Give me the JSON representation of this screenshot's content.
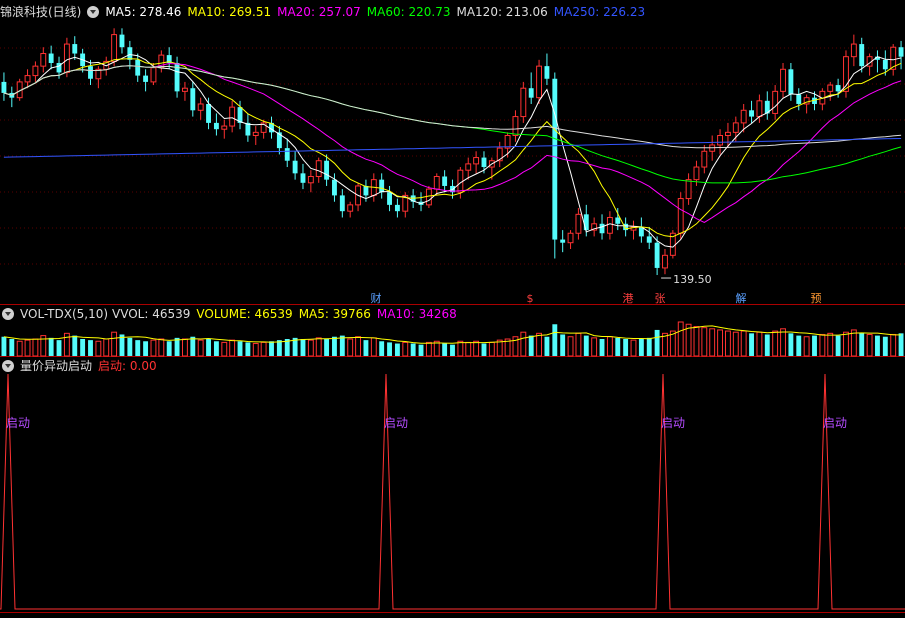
{
  "main": {
    "title": "锦浪科技(日线)",
    "ma": [
      {
        "label": "MA5: 278.46",
        "color": "#ffffff"
      },
      {
        "label": "MA10: 269.51",
        "color": "#ffff00"
      },
      {
        "label": "MA20: 257.07",
        "color": "#ff00ff"
      },
      {
        "label": "MA60: 220.73",
        "color": "#00ff00"
      },
      {
        "label": "MA120: 213.06",
        "color": "#dddddd"
      },
      {
        "label": "MA250: 226.23",
        "color": "#3355ff"
      }
    ],
    "low_marker": "139.50",
    "markers": [
      {
        "text": "财",
        "x": 376,
        "color": "#5aa0ff"
      },
      {
        "text": "$",
        "x": 530,
        "color": "#ff4040"
      },
      {
        "text": "港",
        "x": 628,
        "color": "#ff4040"
      },
      {
        "text": "张",
        "x": 660,
        "color": "#ff4040"
      },
      {
        "text": "解",
        "x": 741,
        "color": "#5aa0ff"
      },
      {
        "text": "预",
        "x": 816,
        "color": "#ff9933"
      }
    ]
  },
  "volume": {
    "title": "VOL-TDX(5,10)",
    "vvol": "VVOL: 46539",
    "volume": "VOLUME: 46539",
    "ma5": "MA5: 39766",
    "ma10": "MA10: 34268"
  },
  "indicator": {
    "title": "量价异动启动",
    "value_label": "启动: 0.00",
    "signal_label": "启动",
    "signals": [
      0.5,
      0.5,
      0.5,
      0.5
    ]
  },
  "colors": {
    "up": "#ff3232",
    "down": "#54fcfc",
    "frame": "#aa0000"
  },
  "chart_data": {
    "type": "candlestick",
    "title": "锦浪科技(日线)",
    "series": [
      {
        "name": "MA5",
        "last": 278.46
      },
      {
        "name": "MA10",
        "last": 269.51
      },
      {
        "name": "MA20",
        "last": 257.07
      },
      {
        "name": "MA60",
        "last": 220.73
      },
      {
        "name": "MA120",
        "last": 213.06
      },
      {
        "name": "MA250",
        "last": 226.23
      }
    ],
    "ohlc": [
      [
        262,
        268,
        250,
        255
      ],
      [
        255,
        259,
        246,
        252
      ],
      [
        252,
        264,
        250,
        262
      ],
      [
        262,
        270,
        258,
        266
      ],
      [
        266,
        275,
        262,
        272
      ],
      [
        272,
        284,
        268,
        280
      ],
      [
        280,
        285,
        270,
        274
      ],
      [
        274,
        278,
        264,
        268
      ],
      [
        268,
        290,
        265,
        286
      ],
      [
        286,
        291,
        276,
        280
      ],
      [
        280,
        283,
        268,
        272
      ],
      [
        272,
        276,
        260,
        264
      ],
      [
        264,
        272,
        258,
        270
      ],
      [
        270,
        278,
        266,
        275
      ],
      [
        275,
        296,
        272,
        292
      ],
      [
        292,
        296,
        280,
        284
      ],
      [
        284,
        288,
        270,
        276
      ],
      [
        276,
        280,
        262,
        266
      ],
      [
        266,
        270,
        256,
        262
      ],
      [
        262,
        274,
        260,
        271
      ],
      [
        271,
        282,
        268,
        279
      ],
      [
        279,
        284,
        270,
        274
      ],
      [
        274,
        278,
        252,
        256
      ],
      [
        256,
        262,
        250,
        258
      ],
      [
        258,
        262,
        240,
        244
      ],
      [
        244,
        252,
        238,
        248
      ],
      [
        248,
        252,
        232,
        236
      ],
      [
        236,
        242,
        228,
        232
      ],
      [
        232,
        238,
        226,
        234
      ],
      [
        234,
        250,
        230,
        246
      ],
      [
        246,
        250,
        232,
        236
      ],
      [
        236,
        242,
        224,
        228
      ],
      [
        228,
        234,
        222,
        230
      ],
      [
        230,
        238,
        226,
        236
      ],
      [
        236,
        240,
        226,
        230
      ],
      [
        230,
        234,
        216,
        220
      ],
      [
        220,
        226,
        208,
        212
      ],
      [
        212,
        218,
        200,
        204
      ],
      [
        204,
        210,
        194,
        198
      ],
      [
        198,
        206,
        192,
        202
      ],
      [
        202,
        214,
        198,
        212
      ],
      [
        212,
        216,
        196,
        200
      ],
      [
        200,
        204,
        186,
        190
      ],
      [
        190,
        194,
        176,
        180
      ],
      [
        180,
        186,
        176,
        184
      ],
      [
        184,
        198,
        180,
        196
      ],
      [
        196,
        200,
        186,
        190
      ],
      [
        190,
        204,
        186,
        200
      ],
      [
        200,
        204,
        188,
        192
      ],
      [
        192,
        196,
        180,
        184
      ],
      [
        184,
        188,
        176,
        180
      ],
      [
        180,
        192,
        176,
        190
      ],
      [
        190,
        194,
        182,
        186
      ],
      [
        186,
        192,
        180,
        184
      ],
      [
        184,
        196,
        182,
        194
      ],
      [
        194,
        204,
        190,
        202
      ],
      [
        202,
        206,
        192,
        196
      ],
      [
        196,
        200,
        188,
        192
      ],
      [
        192,
        208,
        188,
        206
      ],
      [
        206,
        214,
        200,
        210
      ],
      [
        210,
        218,
        204,
        214
      ],
      [
        214,
        218,
        204,
        208
      ],
      [
        208,
        214,
        200,
        212
      ],
      [
        212,
        224,
        208,
        220
      ],
      [
        220,
        230,
        214,
        228
      ],
      [
        228,
        244,
        224,
        240
      ],
      [
        240,
        262,
        236,
        258
      ],
      [
        258,
        268,
        248,
        252
      ],
      [
        252,
        276,
        248,
        272
      ],
      [
        272,
        280,
        260,
        264
      ],
      [
        264,
        268,
        150,
        162
      ],
      [
        162,
        168,
        154,
        160
      ],
      [
        160,
        168,
        156,
        166
      ],
      [
        166,
        182,
        162,
        178
      ],
      [
        178,
        184,
        164,
        168
      ],
      [
        168,
        176,
        164,
        172
      ],
      [
        172,
        178,
        162,
        166
      ],
      [
        166,
        180,
        162,
        176
      ],
      [
        176,
        182,
        168,
        172
      ],
      [
        172,
        176,
        164,
        168
      ],
      [
        168,
        174,
        162,
        170
      ],
      [
        170,
        176,
        160,
        164
      ],
      [
        164,
        170,
        156,
        160
      ],
      [
        160,
        164,
        139.5,
        144
      ],
      [
        144,
        156,
        140,
        152
      ],
      [
        152,
        168,
        150,
        166
      ],
      [
        166,
        192,
        162,
        188
      ],
      [
        188,
        204,
        184,
        200
      ],
      [
        200,
        212,
        196,
        208
      ],
      [
        208,
        222,
        204,
        218
      ],
      [
        218,
        228,
        212,
        222
      ],
      [
        222,
        232,
        216,
        228
      ],
      [
        228,
        236,
        220,
        230
      ],
      [
        230,
        240,
        224,
        236
      ],
      [
        236,
        248,
        230,
        244
      ],
      [
        244,
        250,
        236,
        240
      ],
      [
        240,
        254,
        236,
        250
      ],
      [
        250,
        256,
        238,
        242
      ],
      [
        242,
        260,
        238,
        256
      ],
      [
        256,
        274,
        252,
        270
      ],
      [
        270,
        274,
        250,
        254
      ],
      [
        254,
        258,
        244,
        248
      ],
      [
        248,
        254,
        242,
        252
      ],
      [
        252,
        256,
        244,
        248
      ],
      [
        248,
        258,
        244,
        256
      ],
      [
        256,
        262,
        250,
        260
      ],
      [
        260,
        264,
        252,
        256
      ],
      [
        256,
        282,
        252,
        278
      ],
      [
        278,
        292,
        272,
        286
      ],
      [
        286,
        290,
        268,
        272
      ],
      [
        272,
        280,
        266,
        278
      ],
      [
        278,
        282,
        268,
        276
      ],
      [
        276,
        282,
        266,
        270
      ],
      [
        270,
        286,
        266,
        284
      ],
      [
        284,
        288,
        270,
        278
      ]
    ],
    "volume": [
      34,
      30,
      26,
      28,
      30,
      36,
      32,
      28,
      40,
      36,
      30,
      28,
      26,
      30,
      42,
      38,
      32,
      28,
      26,
      28,
      30,
      26,
      32,
      30,
      34,
      28,
      30,
      26,
      24,
      28,
      26,
      24,
      22,
      24,
      26,
      28,
      30,
      32,
      30,
      28,
      32,
      30,
      34,
      36,
      30,
      34,
      28,
      32,
      26,
      24,
      22,
      24,
      22,
      20,
      24,
      26,
      22,
      20,
      26,
      24,
      26,
      22,
      24,
      28,
      30,
      34,
      42,
      36,
      40,
      34,
      56,
      38,
      34,
      40,
      36,
      32,
      30,
      34,
      32,
      30,
      28,
      30,
      32,
      46,
      40,
      44,
      60,
      56,
      52,
      50,
      48,
      46,
      44,
      42,
      44,
      40,
      42,
      38,
      44,
      48,
      40,
      36,
      34,
      36,
      38,
      40,
      36,
      42,
      46,
      40,
      38,
      36,
      34,
      38,
      40
    ]
  }
}
